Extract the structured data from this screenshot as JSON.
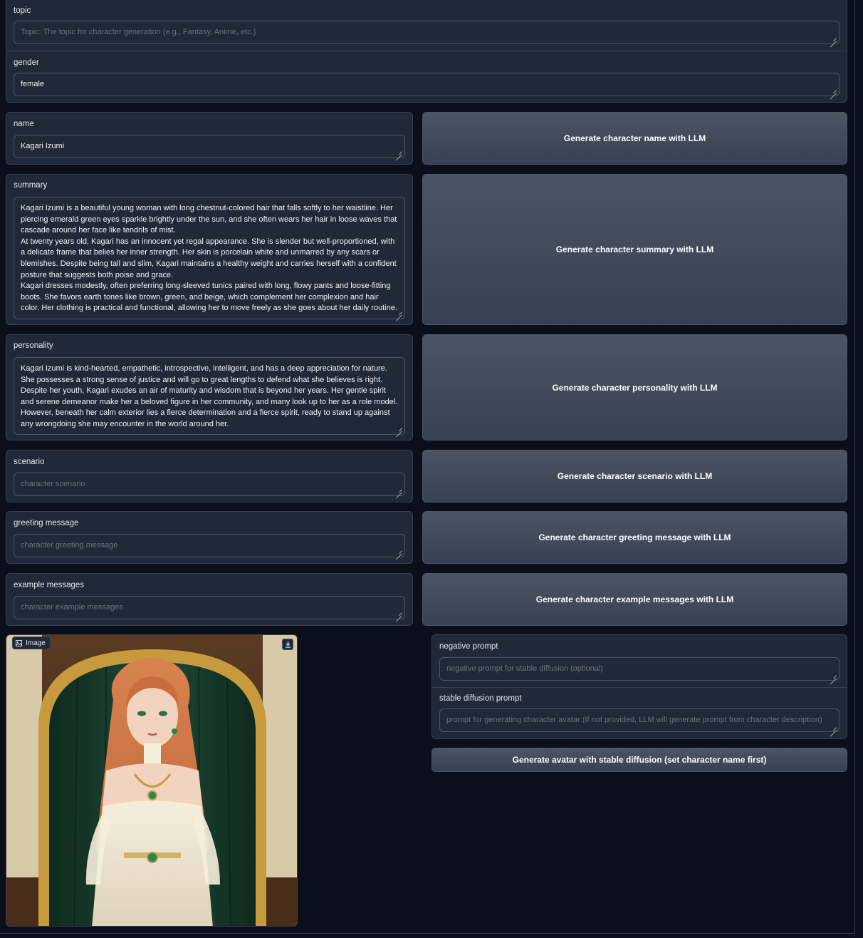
{
  "fields": {
    "topic": {
      "label": "topic",
      "placeholder": "Topic: The topic for character generation (e.g., Fantasy, Anime, etc.)",
      "value": ""
    },
    "gender": {
      "label": "gender",
      "value": "female"
    },
    "name": {
      "label": "name",
      "value": "Kagari Izumi"
    },
    "summary": {
      "label": "summary",
      "value": "Kagari Izumi is a beautiful young woman with long chestnut-colored hair that falls softly to her waistline. Her piercing emerald green eyes sparkle brightly under the sun, and she often wears her hair in loose waves that cascade around her face like tendrils of mist.\nAt twenty years old, Kagari has an innocent yet regal appearance. She is slender but well-proportioned, with a delicate frame that belies her inner strength. Her skin is porcelain white and unmarred by any scars or blemishes. Despite being tall and slim, Kagari maintains a healthy weight and carries herself with a confident posture that suggests both poise and grace.\nKagari dresses modestly, often preferring long-sleeved tunics paired with long, flowy pants and loose-fitting boots. She favors earth tones like brown, green, and beige, which complement her complexion and hair color. Her clothing is practical and functional, allowing her to move freely as she goes about her daily routine."
    },
    "personality": {
      "label": "personality",
      "value": "Kagari Izumi is kind-hearted, empathetic, introspective, intelligent, and has a deep appreciation for nature. She possesses a strong sense of justice and will go to great lengths to defend what she believes is right. Despite her youth, Kagari exudes an air of maturity and wisdom that is beyond her years. Her gentle spirit and serene demeanor make her a beloved figure in her community, and many look up to her as a role model. However, beneath her calm exterior lies a fierce determination and a fierce spirit, ready to stand up against any wrongdoing she may encounter in the world around her."
    },
    "scenario": {
      "label": "scenario",
      "placeholder": "character scenario"
    },
    "greeting": {
      "label": "greeting message",
      "placeholder": "character greeting message"
    },
    "examples": {
      "label": "example messages",
      "placeholder": "character example messages"
    },
    "negative": {
      "label": "negative prompt",
      "placeholder": "negative prompt for stable diffusion (optional)"
    },
    "sd_prompt": {
      "label": "stable diffusion prompt",
      "placeholder": "prompt for generating character avatar (If not provided, LLM will generate prompt from character description)"
    }
  },
  "buttons": {
    "gen_name": "Generate character name with LLM",
    "gen_summary": "Generate character summary with LLM",
    "gen_personality": "Generate character personality with LLM",
    "gen_scenario": "Generate character scenario with LLM",
    "gen_greeting": "Generate character greeting message with LLM",
    "gen_examples": "Generate character example messages with LLM",
    "gen_avatar": "Generate avatar with stable diffusion (set character name first)"
  },
  "image": {
    "tag_label": "Image",
    "icons": {
      "tag": "image-icon",
      "download": "download-icon"
    }
  },
  "colors": {
    "background": "#0b0f19",
    "panel": "#1f2937",
    "border": "#374151",
    "button": "#4b5563"
  }
}
